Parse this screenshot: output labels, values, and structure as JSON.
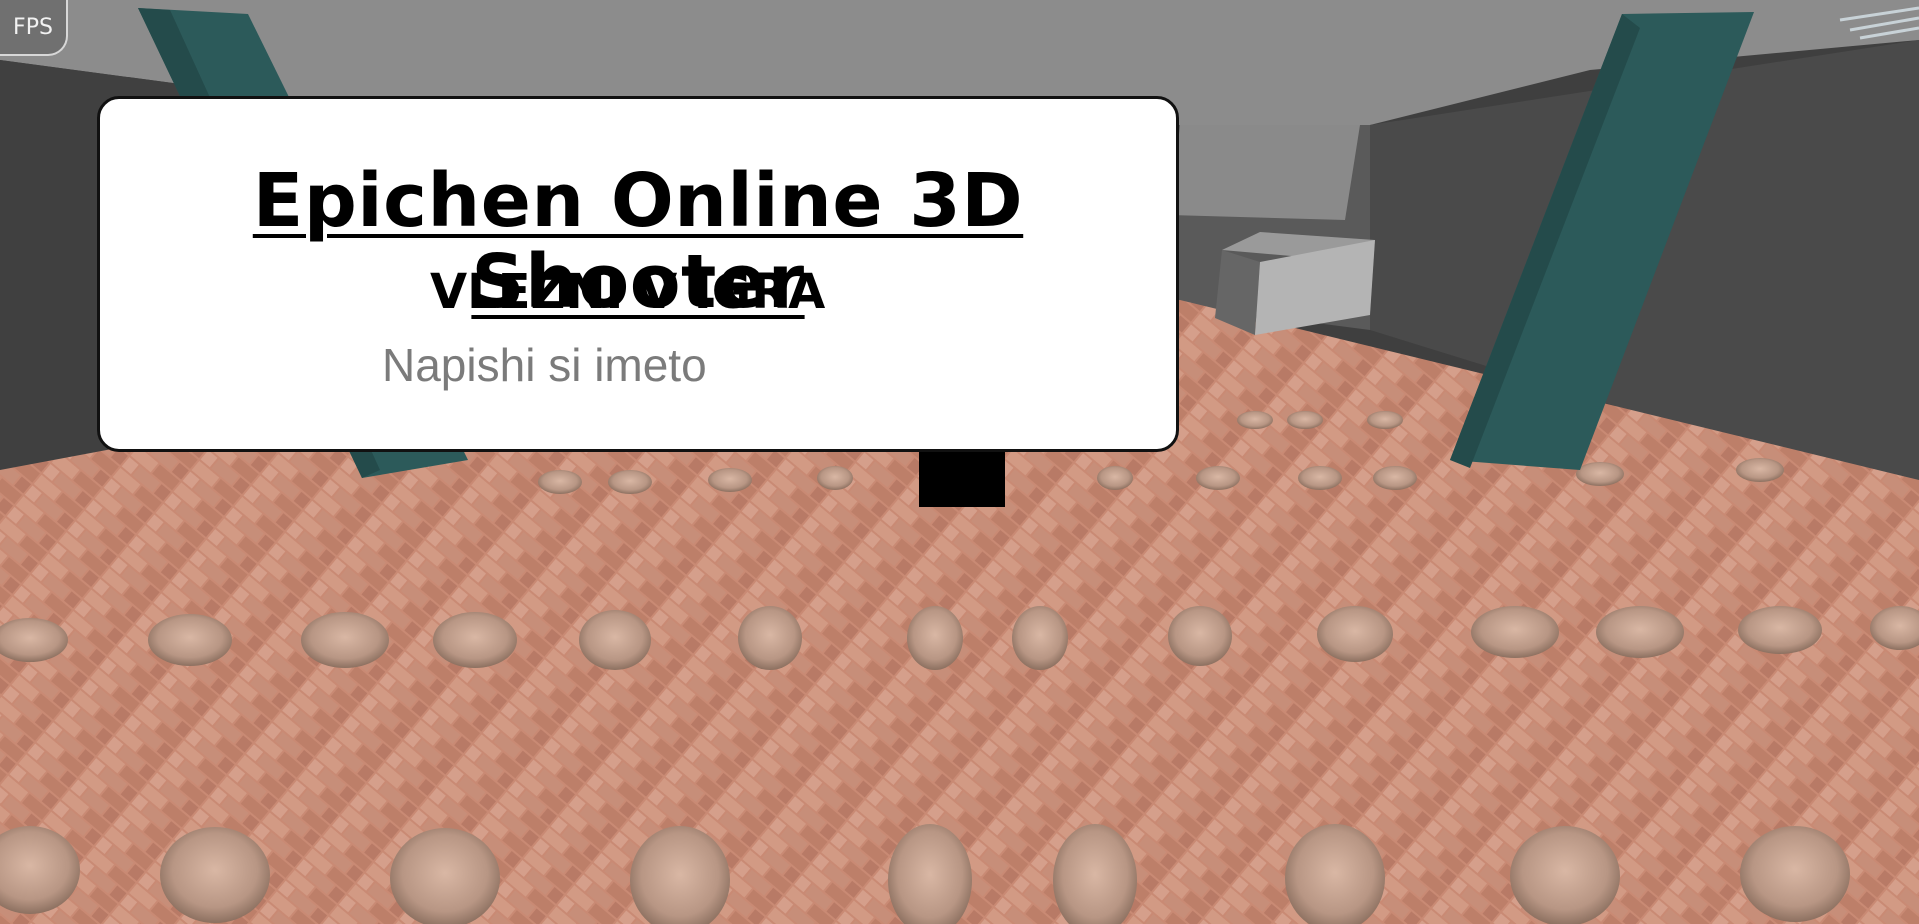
{
  "hud": {
    "fps_label": "FPS"
  },
  "login": {
    "title": "Epichen Online 3D Shooter",
    "enter_label": "VLEZNI V IGRA",
    "name_placeholder": "Napishi si imeto",
    "name_value": ""
  },
  "colors": {
    "ceiling": "#8c8c8c",
    "wall": "#3f3f3f",
    "floor": "#c98a74",
    "pillar": "#2c5a5a",
    "panel_bg": "#ffffff",
    "panel_border": "#111111"
  }
}
